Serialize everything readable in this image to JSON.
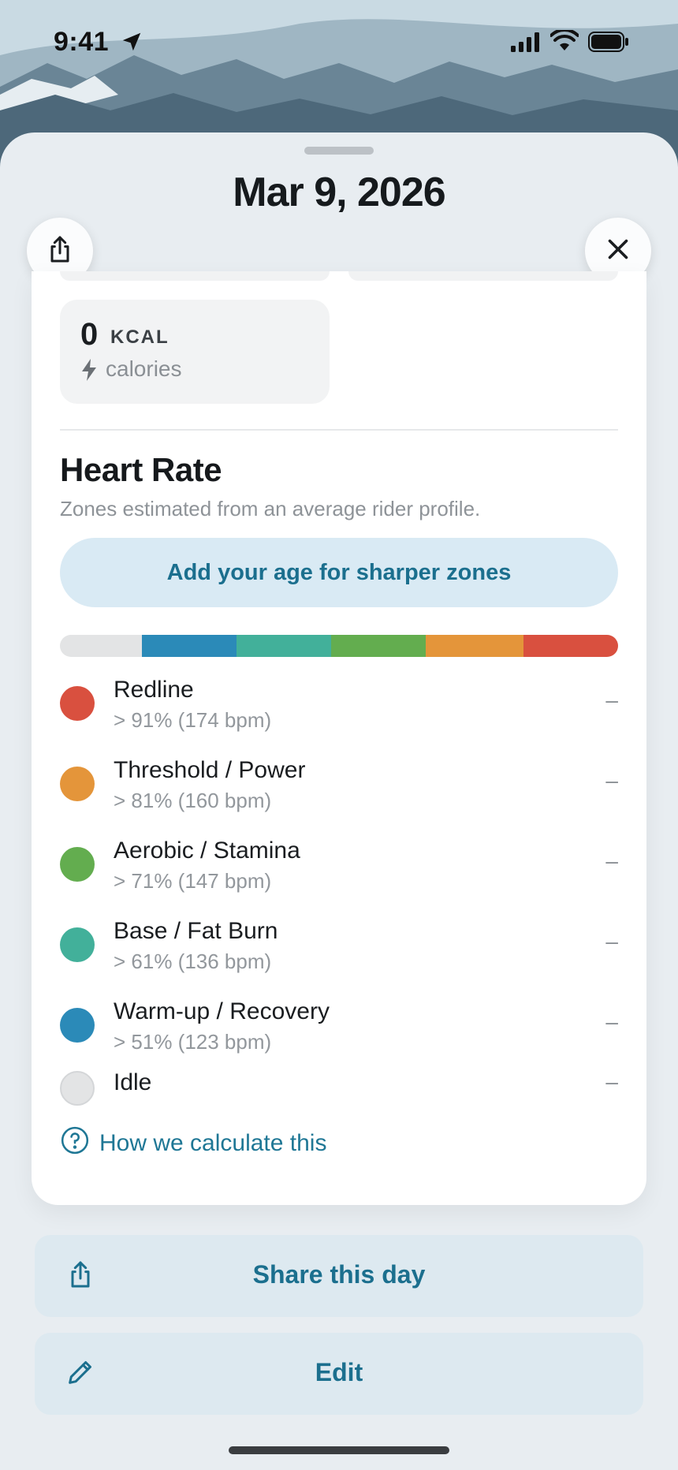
{
  "status_bar": {
    "time": "9:41"
  },
  "sheet": {
    "title": "Mar 9, 2026"
  },
  "calories": {
    "value": "0",
    "unit": "KCAL",
    "label": "calories"
  },
  "heart_rate": {
    "title": "Heart Rate",
    "subtitle": "Zones estimated from an average rider profile.",
    "age_button": "Add your age for sharper zones",
    "zones": [
      {
        "name": "Redline",
        "detail": "> 91% (174 bpm)",
        "value": "–",
        "color": "#d9503f"
      },
      {
        "name": "Threshold / Power",
        "detail": "> 81% (160 bpm)",
        "value": "–",
        "color": "#e4953a"
      },
      {
        "name": "Aerobic / Stamina",
        "detail": "> 71% (147 bpm)",
        "value": "–",
        "color": "#63ad4f"
      },
      {
        "name": "Base / Fat Burn",
        "detail": "> 61% (136 bpm)",
        "value": "–",
        "color": "#42b09a"
      },
      {
        "name": "Warm-up / Recovery",
        "detail": "> 51% (123 bpm)",
        "value": "–",
        "color": "#2b8ab8"
      },
      {
        "name": "Idle",
        "detail": "",
        "value": "–",
        "color": "#e3e4e5"
      }
    ],
    "how_link": "How we calculate this"
  },
  "actions": {
    "share": "Share this day",
    "edit": "Edit"
  }
}
